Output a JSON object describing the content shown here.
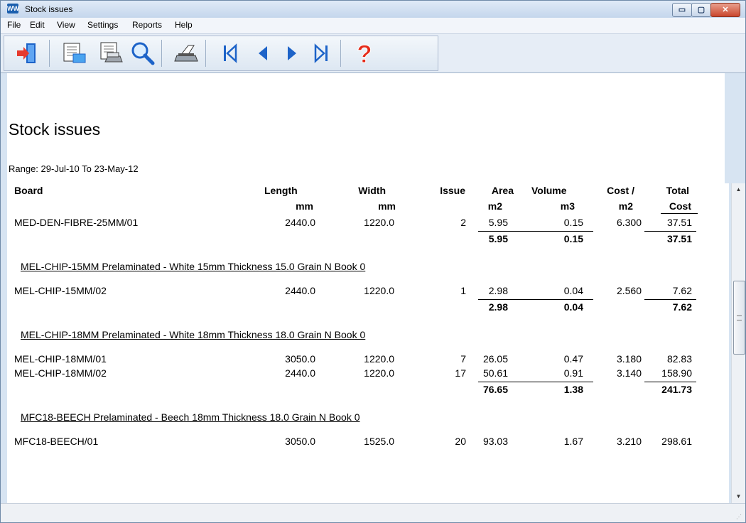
{
  "window": {
    "title": "Stock issues",
    "app_icon_text": "WW"
  },
  "title_buttons": {
    "minimize": "▭",
    "maximize": "▢",
    "close": "✕"
  },
  "menu": [
    "File",
    "Edit",
    "View",
    "Settings",
    "Reports",
    "Help"
  ],
  "toolbar": {
    "icons": [
      "exit-icon",
      "report-preview-icon",
      "report-print-setup-icon",
      "zoom-icon",
      "printer-icon",
      "first-page-icon",
      "previous-page-icon",
      "next-page-icon",
      "last-page-icon",
      "help-icon"
    ],
    "colors": {
      "accent": "#1d63c8",
      "help": "#e52b1a"
    }
  },
  "report": {
    "title": "Stock issues",
    "range": "Range: 29-Jul-10 To 23-May-12",
    "columns": [
      {
        "name": "Board",
        "unit": ""
      },
      {
        "name": "Length",
        "unit": "mm"
      },
      {
        "name": "Width",
        "unit": "mm"
      },
      {
        "name": "Issue",
        "unit": ""
      },
      {
        "name": "Area",
        "unit": "m2"
      },
      {
        "name": "Volume",
        "unit": "m3"
      },
      {
        "name": "Cost /",
        "unit": "m2"
      },
      {
        "name": "Total",
        "unit": "Cost"
      }
    ],
    "rows": [
      {
        "board": "MED-DEN-FIBRE-25MM/01",
        "length": "2440.0",
        "width": "1220.0",
        "issue": "2",
        "area": "5.95",
        "volume": "0.15",
        "cost": "6.300",
        "total": "37.51"
      },
      {
        "subtotal": true,
        "area": "5.95",
        "volume": "0.15",
        "total": "37.51"
      },
      {
        "group": "MEL-CHIP-15MM Prelaminated - White 15mm Thickness  15.0 Grain N Book 0"
      },
      {
        "board": "MEL-CHIP-15MM/02",
        "length": "2440.0",
        "width": "1220.0",
        "issue": "1",
        "area": "2.98",
        "volume": "0.04",
        "cost": "2.560",
        "total": "7.62"
      },
      {
        "subtotal": true,
        "area": "2.98",
        "volume": "0.04",
        "total": "7.62"
      },
      {
        "group": "MEL-CHIP-18MM Prelaminated - White 18mm Thickness  18.0 Grain N Book 0"
      },
      {
        "board": "MEL-CHIP-18MM/01",
        "length": "3050.0",
        "width": "1220.0",
        "issue": "7",
        "area": "26.05",
        "volume": "0.47",
        "cost": "3.180",
        "total": "82.83"
      },
      {
        "board": "MEL-CHIP-18MM/02",
        "length": "2440.0",
        "width": "1220.0",
        "issue": "17",
        "area": "50.61",
        "volume": "0.91",
        "cost": "3.140",
        "total": "158.90"
      },
      {
        "subtotal": true,
        "area": "76.65",
        "volume": "1.38",
        "total": "241.73"
      },
      {
        "group": "MFC18-BEECH Prelaminated - Beech 18mm Thickness  18.0 Grain N Book 0"
      },
      {
        "board": "MFC18-BEECH/01",
        "length": "3050.0",
        "width": "1525.0",
        "issue": "20",
        "area": "93.03",
        "volume": "1.67",
        "cost": "3.210",
        "total": "298.61"
      }
    ]
  }
}
